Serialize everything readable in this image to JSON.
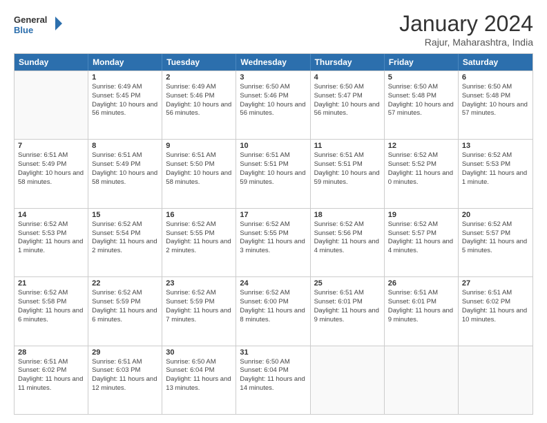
{
  "logo": {
    "line1": "General",
    "line2": "Blue",
    "icon": "▶"
  },
  "title": "January 2024",
  "subtitle": "Rajur, Maharashtra, India",
  "header_days": [
    "Sunday",
    "Monday",
    "Tuesday",
    "Wednesday",
    "Thursday",
    "Friday",
    "Saturday"
  ],
  "weeks": [
    [
      {
        "day": "",
        "empty": true
      },
      {
        "day": "1",
        "sunrise": "6:49 AM",
        "sunset": "5:45 PM",
        "daylight": "10 hours and 56 minutes."
      },
      {
        "day": "2",
        "sunrise": "6:49 AM",
        "sunset": "5:46 PM",
        "daylight": "10 hours and 56 minutes."
      },
      {
        "day": "3",
        "sunrise": "6:50 AM",
        "sunset": "5:46 PM",
        "daylight": "10 hours and 56 minutes."
      },
      {
        "day": "4",
        "sunrise": "6:50 AM",
        "sunset": "5:47 PM",
        "daylight": "10 hours and 56 minutes."
      },
      {
        "day": "5",
        "sunrise": "6:50 AM",
        "sunset": "5:48 PM",
        "daylight": "10 hours and 57 minutes."
      },
      {
        "day": "6",
        "sunrise": "6:50 AM",
        "sunset": "5:48 PM",
        "daylight": "10 hours and 57 minutes."
      }
    ],
    [
      {
        "day": "7",
        "sunrise": "6:51 AM",
        "sunset": "5:49 PM",
        "daylight": "10 hours and 58 minutes."
      },
      {
        "day": "8",
        "sunrise": "6:51 AM",
        "sunset": "5:49 PM",
        "daylight": "10 hours and 58 minutes."
      },
      {
        "day": "9",
        "sunrise": "6:51 AM",
        "sunset": "5:50 PM",
        "daylight": "10 hours and 58 minutes."
      },
      {
        "day": "10",
        "sunrise": "6:51 AM",
        "sunset": "5:51 PM",
        "daylight": "10 hours and 59 minutes."
      },
      {
        "day": "11",
        "sunrise": "6:51 AM",
        "sunset": "5:51 PM",
        "daylight": "10 hours and 59 minutes."
      },
      {
        "day": "12",
        "sunrise": "6:52 AM",
        "sunset": "5:52 PM",
        "daylight": "11 hours and 0 minutes."
      },
      {
        "day": "13",
        "sunrise": "6:52 AM",
        "sunset": "5:53 PM",
        "daylight": "11 hours and 1 minute."
      }
    ],
    [
      {
        "day": "14",
        "sunrise": "6:52 AM",
        "sunset": "5:53 PM",
        "daylight": "11 hours and 1 minute."
      },
      {
        "day": "15",
        "sunrise": "6:52 AM",
        "sunset": "5:54 PM",
        "daylight": "11 hours and 2 minutes."
      },
      {
        "day": "16",
        "sunrise": "6:52 AM",
        "sunset": "5:55 PM",
        "daylight": "11 hours and 2 minutes."
      },
      {
        "day": "17",
        "sunrise": "6:52 AM",
        "sunset": "5:55 PM",
        "daylight": "11 hours and 3 minutes."
      },
      {
        "day": "18",
        "sunrise": "6:52 AM",
        "sunset": "5:56 PM",
        "daylight": "11 hours and 4 minutes."
      },
      {
        "day": "19",
        "sunrise": "6:52 AM",
        "sunset": "5:57 PM",
        "daylight": "11 hours and 4 minutes."
      },
      {
        "day": "20",
        "sunrise": "6:52 AM",
        "sunset": "5:57 PM",
        "daylight": "11 hours and 5 minutes."
      }
    ],
    [
      {
        "day": "21",
        "sunrise": "6:52 AM",
        "sunset": "5:58 PM",
        "daylight": "11 hours and 6 minutes."
      },
      {
        "day": "22",
        "sunrise": "6:52 AM",
        "sunset": "5:59 PM",
        "daylight": "11 hours and 6 minutes."
      },
      {
        "day": "23",
        "sunrise": "6:52 AM",
        "sunset": "5:59 PM",
        "daylight": "11 hours and 7 minutes."
      },
      {
        "day": "24",
        "sunrise": "6:52 AM",
        "sunset": "6:00 PM",
        "daylight": "11 hours and 8 minutes."
      },
      {
        "day": "25",
        "sunrise": "6:51 AM",
        "sunset": "6:01 PM",
        "daylight": "11 hours and 9 minutes."
      },
      {
        "day": "26",
        "sunrise": "6:51 AM",
        "sunset": "6:01 PM",
        "daylight": "11 hours and 9 minutes."
      },
      {
        "day": "27",
        "sunrise": "6:51 AM",
        "sunset": "6:02 PM",
        "daylight": "11 hours and 10 minutes."
      }
    ],
    [
      {
        "day": "28",
        "sunrise": "6:51 AM",
        "sunset": "6:02 PM",
        "daylight": "11 hours and 11 minutes."
      },
      {
        "day": "29",
        "sunrise": "6:51 AM",
        "sunset": "6:03 PM",
        "daylight": "11 hours and 12 minutes."
      },
      {
        "day": "30",
        "sunrise": "6:50 AM",
        "sunset": "6:04 PM",
        "daylight": "11 hours and 13 minutes."
      },
      {
        "day": "31",
        "sunrise": "6:50 AM",
        "sunset": "6:04 PM",
        "daylight": "11 hours and 14 minutes."
      },
      {
        "day": "",
        "empty": true
      },
      {
        "day": "",
        "empty": true
      },
      {
        "day": "",
        "empty": true
      }
    ]
  ]
}
